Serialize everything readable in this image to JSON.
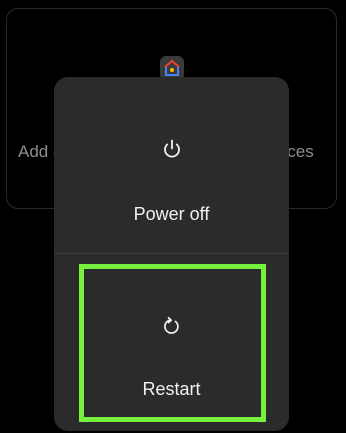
{
  "background": {
    "card_text_left": "Add c",
    "card_text_right": "vices",
    "home_icon": "google-home-icon"
  },
  "power_menu": {
    "options": [
      {
        "label": "Power off",
        "icon": "power-icon"
      },
      {
        "label": "Restart",
        "icon": "restart-icon"
      }
    ]
  },
  "annotation": {
    "highlight_color": "#76f23d",
    "highlighted_option": "Restart"
  },
  "colors": {
    "background": "#000000",
    "menu_surface": "#2b2b2b",
    "text": "#f2f2f2"
  }
}
